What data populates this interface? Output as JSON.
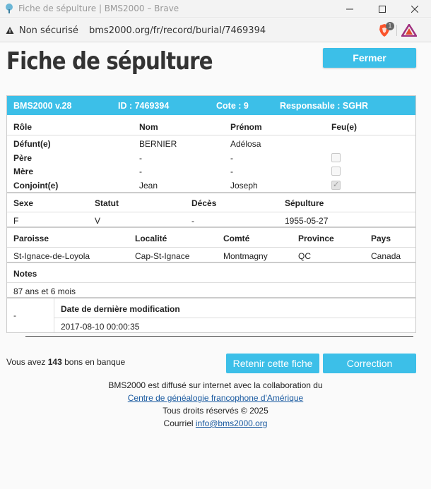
{
  "window": {
    "title": "Fiche de sépulture | BMS2000 – Brave",
    "minimize_icon": "minimize-icon",
    "maximize_icon": "maximize-icon",
    "close_icon": "close-icon"
  },
  "addressbar": {
    "security_label": "Non sécurisé",
    "url": "bms2000.org/fr/record/burial/7469394",
    "shields_badge": "1"
  },
  "page": {
    "title": "Fiche de sépulture",
    "close_button": "Fermer"
  },
  "record": {
    "version": "BMS2000 v.28",
    "id": "ID : 7469394",
    "cote": "Cote : 9",
    "responsable": "Responsable : SGHR",
    "persons_headers": [
      "Rôle",
      "Nom",
      "Prénom",
      "Feu(e)"
    ],
    "persons": [
      {
        "role": "Défunt(e)",
        "nom": "BERNIER",
        "prenom": "Adélosa",
        "feu": null
      },
      {
        "role": "Père",
        "nom": "-",
        "prenom": "-",
        "feu": false
      },
      {
        "role": "Mère",
        "nom": "-",
        "prenom": "-",
        "feu": false
      },
      {
        "role": "Conjoint(e)",
        "nom": "Jean",
        "prenom": "Joseph",
        "feu": true
      }
    ],
    "details_headers": [
      "Sexe",
      "Statut",
      "Décès",
      "Sépulture"
    ],
    "details": {
      "sexe": "F",
      "statut": "V",
      "deces": "-",
      "sepulture": "1955-05-27"
    },
    "place_headers": [
      "Paroisse",
      "Localité",
      "Comté",
      "Province",
      "Pays"
    ],
    "place": {
      "paroisse": "St-Ignace-de-Loyola",
      "localite": "Cap-St-Ignace",
      "comte": "Montmagny",
      "province": "QC",
      "pays": "Canada"
    },
    "notes_header": "Notes",
    "notes": "87 ans et 6 mois",
    "left_dash": "-",
    "modif_header": "Date de dernière modification",
    "modif_date": "2017-08-10 00:00:35"
  },
  "bank": {
    "prefix": "Vous avez",
    "count": "143",
    "suffix": "bons en banque"
  },
  "actions": {
    "retain": "Retenir cette fiche",
    "correction": "Correction"
  },
  "footer": {
    "line1": "BMS2000 est diffusé sur internet avec la collaboration du",
    "link": "Centre de généalogie francophone d'Amérique",
    "copyright": "Tous droits réservés © 2025",
    "mail_label": "Courriel",
    "mail": "info@bms2000.org"
  },
  "colors": {
    "accent": "#3cbfe8",
    "link": "#1a5aa0"
  }
}
